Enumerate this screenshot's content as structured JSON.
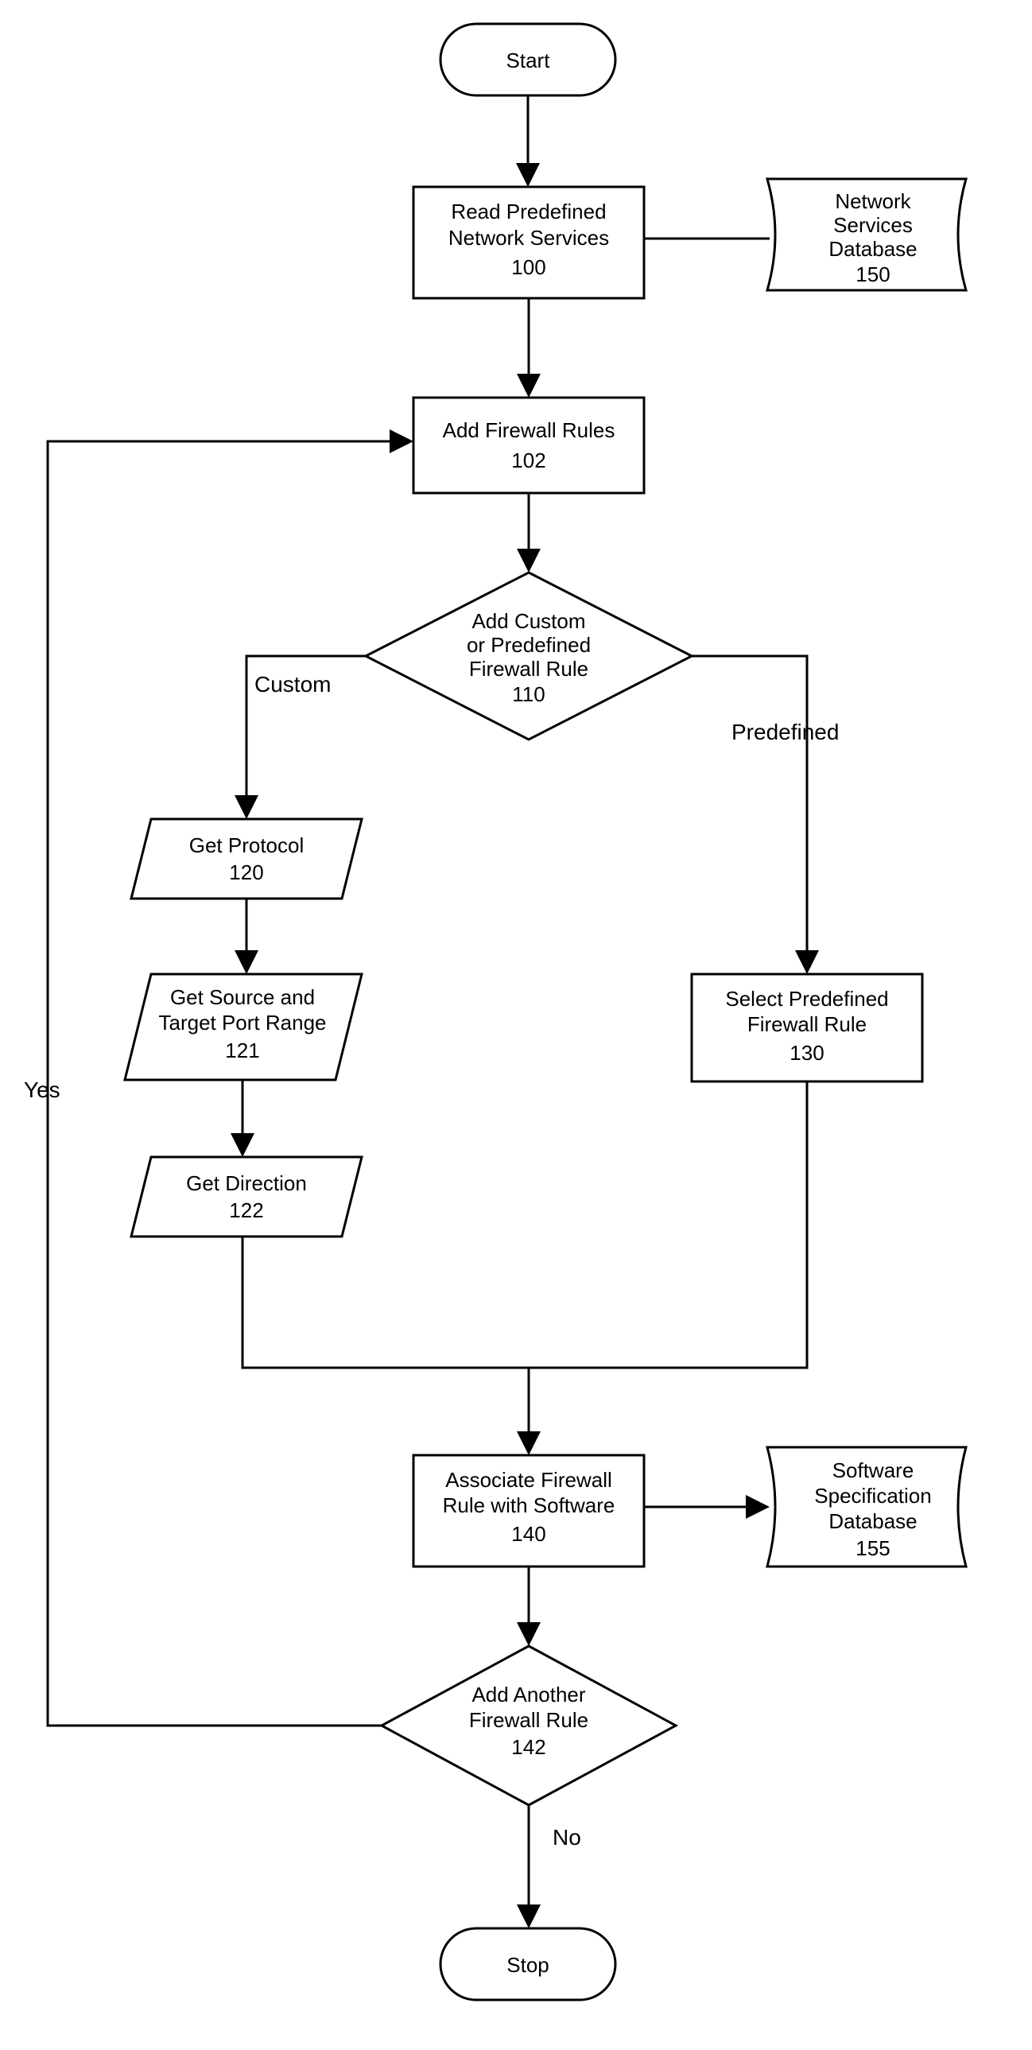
{
  "terminals": {
    "start": "Start",
    "stop": "Stop"
  },
  "processes": {
    "read_services": {
      "l1": "Read Predefined",
      "l2": "Network Services",
      "num": "100"
    },
    "add_rules": {
      "l1": "Add Firewall Rules",
      "num": "102"
    },
    "select_predef": {
      "l1": "Select Predefined",
      "l2": "Firewall Rule",
      "num": "130"
    },
    "associate": {
      "l1": "Associate Firewall",
      "l2": "Rule with Software",
      "num": "140"
    }
  },
  "decisions": {
    "add_custom": {
      "l1": "Add Custom",
      "l2": "or Predefined",
      "l3": "Firewall Rule",
      "num": "110"
    },
    "add_another": {
      "l1": "Add Another",
      "l2": "Firewall Rule",
      "num": "142"
    }
  },
  "io": {
    "get_proto": {
      "l1": "Get Protocol",
      "num": "120"
    },
    "get_ports": {
      "l1": "Get Source and",
      "l2": "Target Port Range",
      "num": "121"
    },
    "get_dir": {
      "l1": "Get Direction",
      "num": "122"
    }
  },
  "databases": {
    "net_services": {
      "l1": "Network",
      "l2": "Services",
      "l3": "Database",
      "num": "150"
    },
    "sw_spec": {
      "l1": "Software",
      "l2": "Specification",
      "l3": "Database",
      "num": "155"
    }
  },
  "edge_labels": {
    "custom": "Custom",
    "predefined": "Predefined",
    "yes": "Yes",
    "no": "No"
  }
}
